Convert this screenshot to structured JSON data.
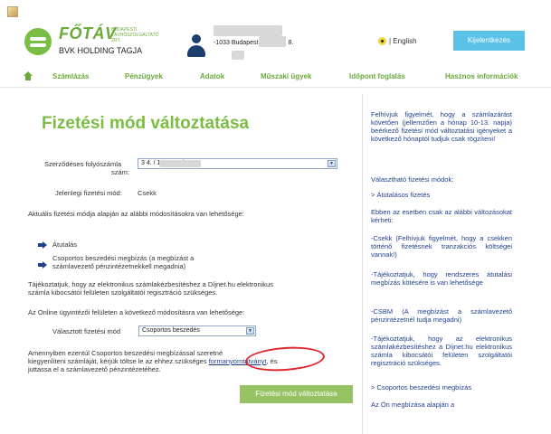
{
  "header": {
    "brand": "FŐTÁV",
    "brand_sub": "BUDAPESTI TÁVHŐSZOLGÁLTATÓ ZRT.",
    "holding": "BVK HOLDING TAGJA",
    "address": "-1033 Budapest,            4. 2. em. 8.",
    "language": "| English",
    "logout_label": "Kijelentkezés"
  },
  "nav": {
    "items": [
      "Számlázás",
      "Pénzügyek",
      "Adatok",
      "Műszaki ügyek",
      "Időpont foglalás",
      "Hasznos információk"
    ]
  },
  "main": {
    "title": "Fizetési mód változtatása",
    "contract_label_1": "Szerződéses folyószámla",
    "contract_label_2": "szám:",
    "contract_value": "3                                4. / 1033 Budapest",
    "current_label": "Jelenlegi fizetési mód:",
    "current_value": "Csekk",
    "options_intro": "Aktuális fizetési módja alapján az alábbi módosításokra van lehetősége:",
    "option_1": "Átutalás",
    "option_2_line1": "Csoportos beszedési megbízás (a megbízást a",
    "option_2_line2": "számlavezető pénzintézetnekkell megadnia)",
    "notice_line1": "Tájékoztatjuk, hogy az elektronikus számlakézbesítéshez a Díjnet.hu elektronikus",
    "notice_line2": "számla kibocsátói felületen szolgáltatói regisztráció szükséges.",
    "online_intro": "Az Online ügyintézői felületen a következő módosításra van lehetősége:",
    "selected_label": "Választott fizetési mód",
    "selected_value": "Csoportos beszedés",
    "info_line1": "Amennyiben ezentúl Csoportos beszedési megbízással szeretné",
    "info_line2_a": "kiegyenlíteni számláját, kérjük töltse le az ehhez szükséges",
    "info_link": "formanyomtatványt",
    "info_line2_b": ", és",
    "info_line3": "juttassa el a számlavezető pénzintézetéhez.",
    "submit_label": "Fizetési mód változtatása"
  },
  "sidebar": {
    "p1": "Felhívjuk figyelmét, hogy a számlazárást követően (jellemzően a hónap 10-13. napja) beérkező fizetési mód változtatási igényeket a következő hónaptól tudjuk csak rögzíteni!",
    "p2": "Választható fizetési módok:",
    "p3": "> Átutalásos fizetés",
    "p4": "Ebben az esetben csak az alábbi változásokat kérheti:",
    "p5": "-Csekk (Felhívjuk figyelmét, hogy a csekken történő fizetésnek tranzakciós költségei vannak!)",
    "p6": "-Tájékoztatjuk, hogy rendszeres átutalási megbízás kötésére is van lehetősége",
    "p7": "-CSBM (A megbízást a számlavezető pénzintézetnél tudja megadni)",
    "p8": "-Tájékoztatjuk, hogy az elektronikus számlakézbesítéshez a Díjnet.hu elektronikus számla kibocsátói felületen szolgáltatói regisztráció szükséges.",
    "p9": "> Csoportos beszedési megbízás",
    "p10": "Az Ön megbízása alapján a"
  }
}
